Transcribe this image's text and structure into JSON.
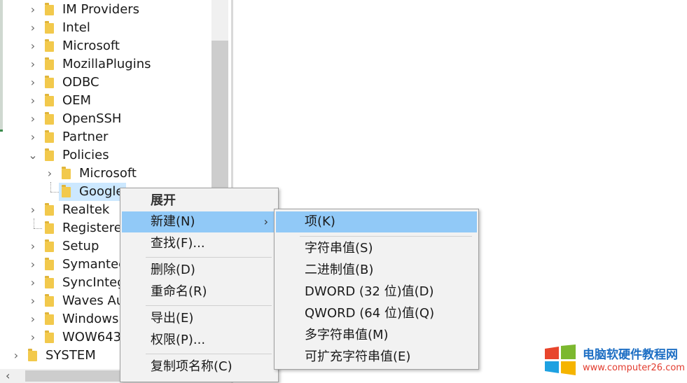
{
  "tree": {
    "items": [
      {
        "label": "IM Providers",
        "chevron": "right"
      },
      {
        "label": "Intel",
        "chevron": "right"
      },
      {
        "label": "Microsoft",
        "chevron": "right"
      },
      {
        "label": "MozillaPlugins",
        "chevron": "right"
      },
      {
        "label": "ODBC",
        "chevron": "right"
      },
      {
        "label": "OEM",
        "chevron": "right"
      },
      {
        "label": "OpenSSH",
        "chevron": "right"
      },
      {
        "label": "Partner",
        "chevron": "right"
      },
      {
        "label": "Policies",
        "chevron": "down"
      },
      {
        "label": "Microsoft",
        "chevron": "right"
      },
      {
        "label": "Google",
        "chevron": "none",
        "selected": true
      },
      {
        "label": "Realtek",
        "chevron": "right"
      },
      {
        "label": "Registere",
        "chevron": "none"
      },
      {
        "label": "Setup",
        "chevron": "right"
      },
      {
        "label": "Symantec",
        "chevron": "right"
      },
      {
        "label": "SyncInteg",
        "chevron": "right"
      },
      {
        "label": "Waves Au",
        "chevron": "right"
      },
      {
        "label": "Windows",
        "chevron": "right"
      },
      {
        "label": "WOW643",
        "chevron": "right"
      },
      {
        "label": "SYSTEM",
        "chevron": "right"
      }
    ]
  },
  "context_menu": {
    "expand": "展开",
    "new": "新建(N)",
    "find": "查找(F)...",
    "delete": "删除(D)",
    "rename": "重命名(R)",
    "export": "导出(E)",
    "permissions": "权限(P)...",
    "copy_key_name": "复制项名称(C)"
  },
  "submenu": {
    "key": "项(K)",
    "string_value": "字符串值(S)",
    "binary_value": "二进制值(B)",
    "dword_value": "DWORD (32 位)值(D)",
    "qword_value": "QWORD (64 位)值(Q)",
    "multi_string_value": "多字符串值(M)",
    "expandable_string_value": "可扩充字符串值(E)"
  },
  "watermark": {
    "title": "电脑软硬件教程网",
    "url": "www.computer26.com"
  },
  "colors": {
    "highlight": "#91c9f7",
    "selection": "#cce8ff",
    "folder": "#f2c94c"
  }
}
